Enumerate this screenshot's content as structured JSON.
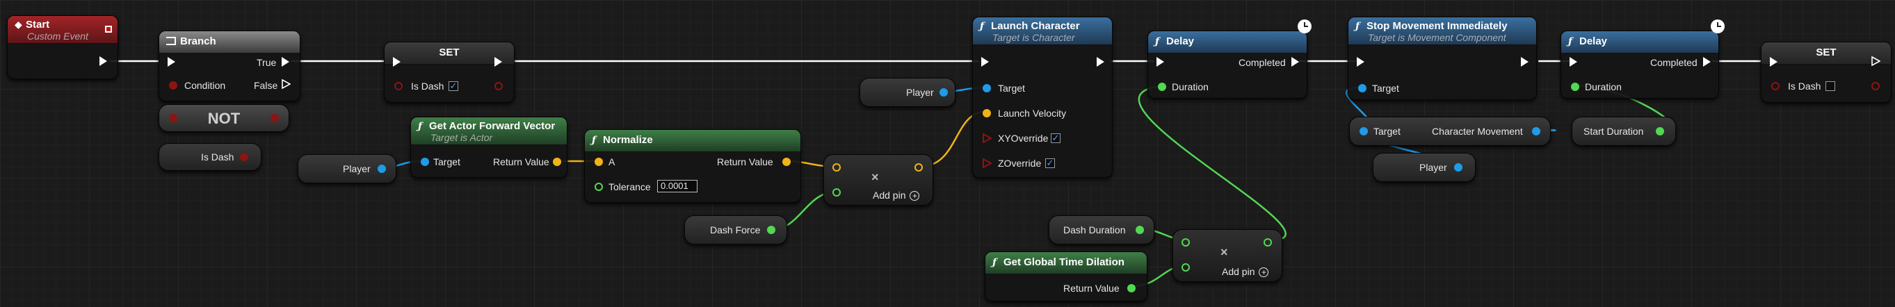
{
  "nodes": {
    "start": {
      "title": "Start",
      "subtitle": "Custom Event"
    },
    "branch": {
      "title": "Branch",
      "pins": {
        "condition": "Condition",
        "true": "True",
        "false": "False"
      }
    },
    "not": {
      "title": "NOT"
    },
    "is_dash_getter": {
      "label": "Is Dash"
    },
    "set1": {
      "title": "SET",
      "pin": "Is Dash"
    },
    "player1": {
      "label": "Player"
    },
    "forward": {
      "title": "Get Actor Forward Vector",
      "subtitle": "Target is Actor",
      "pins": {
        "target": "Target",
        "return": "Return Value"
      }
    },
    "normalize": {
      "title": "Normalize",
      "pins": {
        "a": "A",
        "return": "Return Value",
        "tolerance": "Tolerance"
      },
      "tolerance_value": "0.0001"
    },
    "dash_force": {
      "label": "Dash Force"
    },
    "mul1": {
      "add_pin": "Add pin"
    },
    "player2": {
      "label": "Player"
    },
    "launch": {
      "title": "Launch Character",
      "subtitle": "Target is Character",
      "pins": {
        "target": "Target",
        "velocity": "Launch Velocity",
        "xy": "XYOverride",
        "z": "ZOverride"
      }
    },
    "delay1": {
      "title": "Delay",
      "pins": {
        "completed": "Completed",
        "duration": "Duration"
      }
    },
    "dash_duration": {
      "label": "Dash Duration"
    },
    "time_dilation": {
      "title": "Get Global Time Dilation",
      "pins": {
        "return": "Return Value"
      }
    },
    "mul2": {
      "add_pin": "Add pin"
    },
    "stop": {
      "title": "Stop Movement Immediately",
      "subtitle": "Target is Movement Component",
      "pins": {
        "target": "Target"
      }
    },
    "char_move": {
      "pins": {
        "target": "Target",
        "out": "Character Movement"
      }
    },
    "player3": {
      "label": "Player"
    },
    "delay2": {
      "title": "Delay",
      "pins": {
        "completed": "Completed",
        "duration": "Duration"
      }
    },
    "start_duration": {
      "label": "Start Duration"
    },
    "set2": {
      "title": "SET",
      "pin": "Is Dash"
    }
  },
  "icons": [
    "event-icon",
    "branch-icon",
    "function-icon",
    "clock-icon",
    "multiply-icon",
    "plus-icon"
  ],
  "colors": {
    "exec": "#ffffff",
    "boolean": "#8c1414",
    "float": "#52d852",
    "object": "#1f9be8",
    "vector": "#f0b418",
    "event": "#a32428",
    "function": "#3a6f9e",
    "pure": "#3f7f47"
  }
}
